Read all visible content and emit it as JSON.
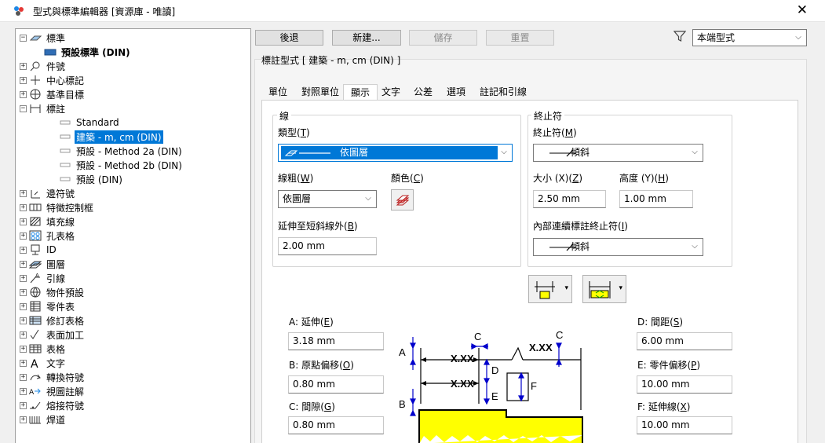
{
  "window": {
    "title": "型式與標準編輯器 [資源庫 - 唯讀]",
    "close_glyph": "✕"
  },
  "tree": {
    "items": [
      {
        "label": "標準",
        "exp": "−",
        "icon": "standard-icon"
      },
      {
        "label": "預設標準 (DIN)",
        "exp": "",
        "icon": "active-standard-icon"
      },
      {
        "label": "件號",
        "exp": "+",
        "icon": "balloon-icon"
      },
      {
        "label": "中心標記",
        "exp": "+",
        "icon": "center-mark-icon"
      },
      {
        "label": "基準目標",
        "exp": "+",
        "icon": "datum-target-icon"
      },
      {
        "label": "標註",
        "exp": "−",
        "icon": "dimension-icon"
      },
      {
        "label": "Standard",
        "exp": "",
        "icon": "style-item-icon"
      },
      {
        "label": "建築 - m, cm (DIN)",
        "exp": "",
        "icon": "style-item-icon"
      },
      {
        "label": "預設 - Method 2a (DIN)",
        "exp": "",
        "icon": "style-item-icon"
      },
      {
        "label": "預設 - Method 2b (DIN)",
        "exp": "",
        "icon": "style-item-icon"
      },
      {
        "label": "預設 (DIN)",
        "exp": "",
        "icon": "style-item-icon"
      },
      {
        "label": "邊符號",
        "exp": "+",
        "icon": "edge-symbol-icon"
      },
      {
        "label": "特徵控制框",
        "exp": "+",
        "icon": "feature-control-frame-icon"
      },
      {
        "label": "填充線",
        "exp": "+",
        "icon": "hatch-icon"
      },
      {
        "label": "孔表格",
        "exp": "+",
        "icon": "hole-table-icon"
      },
      {
        "label": "ID",
        "exp": "+",
        "icon": "id-icon"
      },
      {
        "label": "圖層",
        "exp": "+",
        "icon": "layers-icon"
      },
      {
        "label": "引線",
        "exp": "+",
        "icon": "leader-icon"
      },
      {
        "label": "物件預設",
        "exp": "+",
        "icon": "object-defaults-icon"
      },
      {
        "label": "零件表",
        "exp": "+",
        "icon": "parts-list-icon"
      },
      {
        "label": "修訂表格",
        "exp": "+",
        "icon": "revision-table-icon"
      },
      {
        "label": "表面加工",
        "exp": "+",
        "icon": "surface-texture-icon"
      },
      {
        "label": "表格",
        "exp": "+",
        "icon": "table-icon"
      },
      {
        "label": "文字",
        "exp": "+",
        "icon": "text-icon"
      },
      {
        "label": "轉換符號",
        "exp": "+",
        "icon": "convert-symbol-icon"
      },
      {
        "label": "視圖註解",
        "exp": "+",
        "icon": "view-annotation-icon"
      },
      {
        "label": "熔接符號",
        "exp": "+",
        "icon": "weld-symbol-icon"
      },
      {
        "label": "焊道",
        "exp": "+",
        "icon": "weld-bead-icon"
      }
    ]
  },
  "toolbar": {
    "back": "後退",
    "new": "新建...",
    "save": "儲存",
    "reset": "重置",
    "filter": "本端型式"
  },
  "style_caption": "標註型式 [ 建築 - m, cm (DIN) ]",
  "tabs": [
    "單位",
    "對照單位",
    "顯示",
    "文字",
    "公差",
    "選項",
    "註記和引線"
  ],
  "line_group": {
    "title": "線",
    "type_label": "類型(",
    "type_key": "T",
    "type_value": "依圖層",
    "weight_label": "線粗(",
    "weight_key": "W",
    "weight_value": "依圖層",
    "color_label": "顏色(",
    "color_key": "C",
    "extend_label": "延伸至短斜線外(",
    "extend_key": "B",
    "extend_value": "2.00 mm"
  },
  "term_group": {
    "title": "終止符",
    "term_label": "終止符(",
    "term_key": "M",
    "term_value": "傾斜",
    "size_label": "大小 (X)(",
    "size_key": "Z",
    "size_value": "2.50 mm",
    "height_label": "高度 (Y)(",
    "height_key": "H",
    "height_value": "1.00 mm",
    "inner_label": "內部連續標註終止符(",
    "inner_key": "I",
    "inner_value": "傾斜"
  },
  "spacing": {
    "a_label": "A: 延伸(",
    "a_key": "E",
    "a_value": "3.18 mm",
    "b_label": "B: 原點偏移(",
    "b_key": "O",
    "b_value": "0.80 mm",
    "c_label": "C: 間隙(",
    "c_key": "G",
    "c_value": "0.80 mm",
    "d_label": "D: 間距(",
    "d_key": "S",
    "d_value": "6.00 mm",
    "e_label": "E: 零件偏移(",
    "e_key": "P",
    "e_value": "10.00 mm",
    "f_label": "F: 延伸線(",
    "f_key": "X",
    "f_value": "10.00 mm"
  },
  "diagram": {
    "letters": [
      "A",
      "B",
      "C",
      "C",
      "D",
      "E",
      "F"
    ],
    "dim_text": "X.XX"
  },
  "close_paren": ")",
  "colors": {
    "accent": "#0078d7",
    "part_fill": "#ffff00",
    "dim_blue": "#0000cc"
  }
}
